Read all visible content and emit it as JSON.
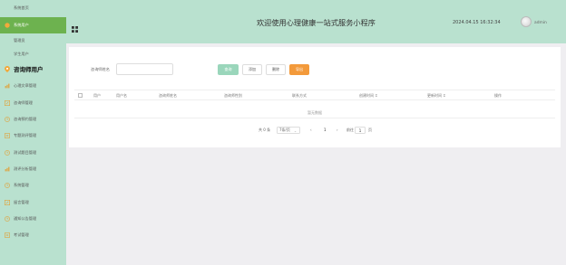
{
  "sidebar": {
    "items": [
      {
        "label": "系统首页",
        "icon": "none"
      },
      {
        "label": "系统用户",
        "icon": "user-icon",
        "active": true
      },
      {
        "label": "管理员",
        "icon": "none",
        "sub": true
      },
      {
        "label": "学生用户",
        "icon": "none",
        "sub": true
      },
      {
        "label": "咨询师用户",
        "icon": "map-pin-icon",
        "section": true
      },
      {
        "label": "心理文章管理",
        "icon": "chart-icon"
      },
      {
        "label": "咨询师管理",
        "icon": "edit-icon"
      },
      {
        "label": "咨询预约管理",
        "icon": "clock-icon"
      },
      {
        "label": "专题测评管理",
        "icon": "doc-icon"
      },
      {
        "label": "测试题目管理",
        "icon": "clock-icon"
      },
      {
        "label": "测评分析管理",
        "icon": "chart-icon"
      },
      {
        "label": "系统管理",
        "icon": "clock-icon"
      },
      {
        "label": "留言管理",
        "icon": "edit-icon"
      },
      {
        "label": "通知公告管理",
        "icon": "clock-icon"
      },
      {
        "label": "考试管理",
        "icon": "doc-icon"
      }
    ]
  },
  "header": {
    "title": "欢迎使用心理健康一站式服务小程序",
    "datetime": "2024.04.15 16:32:34",
    "username": "admin"
  },
  "search": {
    "label": "咨询师姓名",
    "value": "",
    "placeholder": ""
  },
  "toolbar": {
    "search_label": "查询",
    "add_label": "添加",
    "delete_label": "删除",
    "export_label": "导出"
  },
  "table": {
    "columns": [
      "用户",
      "用户名",
      "咨询师姓名",
      "咨询师性别",
      "联系方式",
      "创建时间 ↕",
      "更新时间 ↕",
      "操作"
    ],
    "empty_text": "暂无数据"
  },
  "pagination": {
    "total": "共 0 条",
    "page_size": "7条/页",
    "prev": "‹",
    "current": "1",
    "next": "›",
    "goto_label": "前往",
    "goto_value": "1",
    "page_suffix": "页"
  }
}
